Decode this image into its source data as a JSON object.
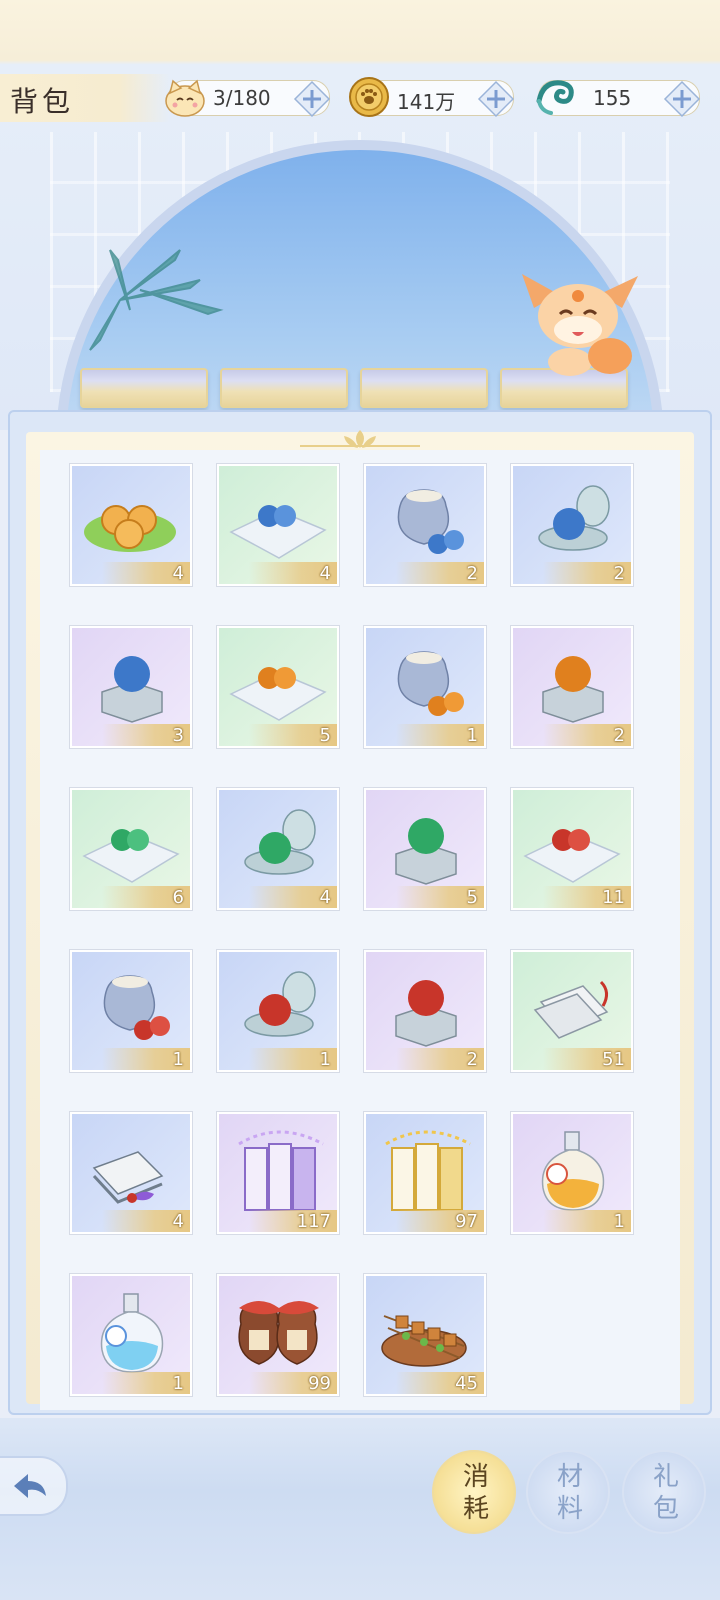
{
  "header": {
    "title": "背包",
    "currencies": [
      {
        "name": "bag-capacity",
        "icon": "cat-face-icon",
        "value": "3/180"
      },
      {
        "name": "coins",
        "icon": "paw-coin-icon",
        "value": "141万"
      },
      {
        "name": "jade",
        "icon": "jade-dragon-icon",
        "value": "155"
      }
    ]
  },
  "inventory": {
    "items": [
      {
        "icon": "mooncake-on-leaf-icon",
        "count": "4"
      },
      {
        "icon": "blue-pearls-on-cloth-icon",
        "count": "4"
      },
      {
        "icon": "blue-pearl-pouch-icon",
        "count": "2"
      },
      {
        "icon": "blue-pearl-in-case-icon",
        "count": "2"
      },
      {
        "icon": "blue-pearl-on-box-icon",
        "count": "3"
      },
      {
        "icon": "orange-pearls-on-cloth-icon",
        "count": "5"
      },
      {
        "icon": "orange-pearl-pouch-icon",
        "count": "1"
      },
      {
        "icon": "orange-pearl-on-box-icon",
        "count": "2"
      },
      {
        "icon": "green-pearls-on-cloth-icon",
        "count": "6"
      },
      {
        "icon": "green-pearl-in-case-icon",
        "count": "4"
      },
      {
        "icon": "green-pearl-on-box-icon",
        "count": "5"
      },
      {
        "icon": "red-pearls-on-cloth-icon",
        "count": "11"
      },
      {
        "icon": "red-pearl-pouch-icon",
        "count": "1"
      },
      {
        "icon": "red-pearl-in-case-icon",
        "count": "1"
      },
      {
        "icon": "red-pearl-on-box-icon",
        "count": "2"
      },
      {
        "icon": "scroll-pages-icon",
        "count": "51"
      },
      {
        "icon": "bound-book-icon",
        "count": "4"
      },
      {
        "icon": "purple-books-icon",
        "count": "117"
      },
      {
        "icon": "golden-books-icon",
        "count": "97"
      },
      {
        "icon": "double-potion-orange-icon",
        "count": "1"
      },
      {
        "icon": "double-potion-blue-icon",
        "count": "1"
      },
      {
        "icon": "wine-jars-icon",
        "count": "99"
      },
      {
        "icon": "skewers-icon",
        "count": "45"
      }
    ]
  },
  "tabs": [
    {
      "label_top": "消",
      "label_bottom": "耗",
      "active": true
    },
    {
      "label_top": "材",
      "label_bottom": "料",
      "active": false
    },
    {
      "label_top": "礼",
      "label_bottom": "包",
      "active": false
    }
  ],
  "colors": {
    "accent_gold": "#e6c784",
    "panel_blue": "#dce7f7"
  }
}
